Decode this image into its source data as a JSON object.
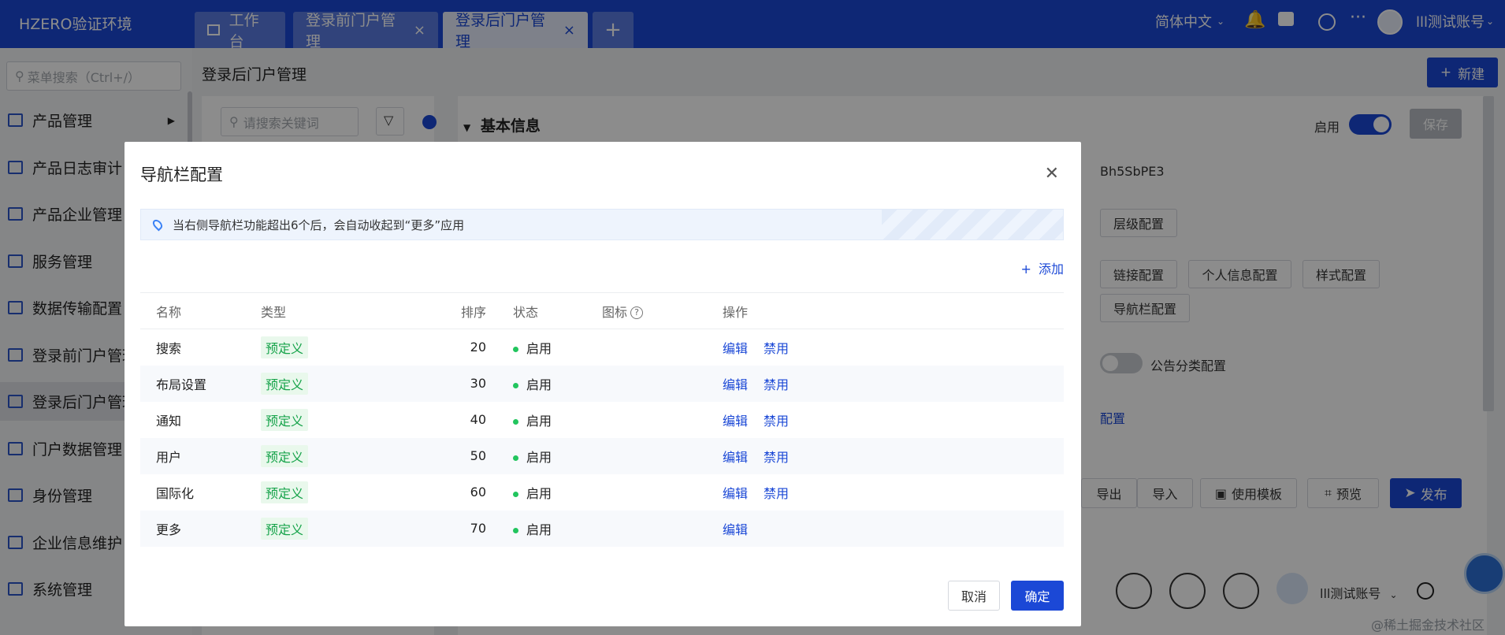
{
  "app": {
    "brand": "HZERO验证环境"
  },
  "tabs": [
    {
      "label": "工作台"
    },
    {
      "label": "登录前门户管理"
    },
    {
      "label": "登录后门户管理"
    }
  ],
  "topbar": {
    "language": "简体中文",
    "user": "lll测试账号"
  },
  "sidebar": {
    "search_placeholder": "菜单搜索（Ctrl+/）",
    "items": [
      {
        "label": "产品管理"
      },
      {
        "label": "产品日志审计"
      },
      {
        "label": "产品企业管理"
      },
      {
        "label": "服务管理"
      },
      {
        "label": "数据传输配置"
      },
      {
        "label": "登录前门户管理"
      },
      {
        "label": "登录后门户管理"
      },
      {
        "label": "门户数据管理"
      },
      {
        "label": "身份管理"
      },
      {
        "label": "企业信息维护"
      },
      {
        "label": "系统管理"
      }
    ]
  },
  "page": {
    "title": "登录后门户管理",
    "new_label": "新建",
    "search_placeholder": "请搜索关键词",
    "section_title": "基本信息",
    "enable_label": "启用",
    "save_label": "保存",
    "code": "Bh5SbPE3",
    "config_buttons": [
      "层级配置",
      "链接配置",
      "个人信息配置",
      "样式配置",
      "导航栏配置"
    ],
    "notice_config": "公告分类配置",
    "link_config": "配置",
    "actions": [
      "导出",
      "导入",
      "使用模板",
      "预览"
    ],
    "publish_label": "发布",
    "preview_user": "lll测试账号",
    "watermark_tag": "@稀土掘金技术社区"
  },
  "modal": {
    "title": "导航栏配置",
    "info": "当右侧导航栏功能超出6个后，会自动收起到“更多”应用",
    "add_label": "添加",
    "columns": [
      "名称",
      "类型",
      "排序",
      "状态",
      "图标",
      "操作"
    ],
    "rows": [
      {
        "name": "搜索",
        "type": "预定义",
        "order": "20",
        "status": "启用",
        "edit": "编辑",
        "disable": "禁用"
      },
      {
        "name": "布局设置",
        "type": "预定义",
        "order": "30",
        "status": "启用",
        "edit": "编辑",
        "disable": "禁用"
      },
      {
        "name": "通知",
        "type": "预定义",
        "order": "40",
        "status": "启用",
        "edit": "编辑",
        "disable": "禁用"
      },
      {
        "name": "用户",
        "type": "预定义",
        "order": "50",
        "status": "启用",
        "edit": "编辑",
        "disable": "禁用"
      },
      {
        "name": "国际化",
        "type": "预定义",
        "order": "60",
        "status": "启用",
        "edit": "编辑",
        "disable": "禁用"
      },
      {
        "name": "更多",
        "type": "预定义",
        "order": "70",
        "status": "启用",
        "edit": "编辑",
        "disable": ""
      }
    ],
    "cancel_label": "取消",
    "ok_label": "确定"
  },
  "colors": {
    "primary": "#1b48d6",
    "success": "#22c55e",
    "tag_bg": "#e9f8ec"
  }
}
